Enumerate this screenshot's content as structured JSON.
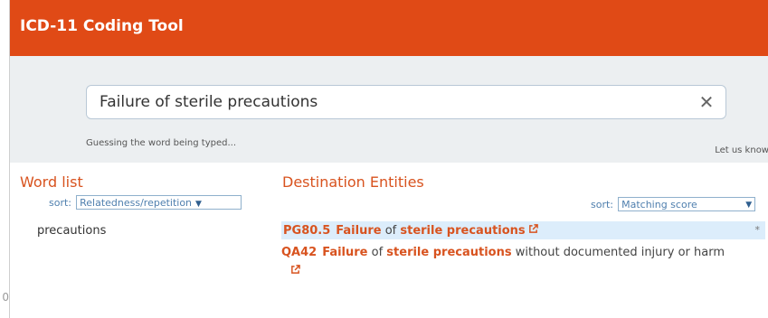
{
  "edge": {
    "digit": "0"
  },
  "header": {
    "title": "ICD-11 Coding Tool"
  },
  "search": {
    "value": "Failure of sterile precautions",
    "clear_glyph": "✕",
    "hint": "Guessing the word being typed...",
    "feedback_text": "Let us know"
  },
  "word_list": {
    "title": "Word list",
    "sort_label": "sort:",
    "sort_value": "Relatedness/repetition",
    "items": [
      "precautions"
    ]
  },
  "destination": {
    "title": "Destination Entities",
    "sort_label": "sort:",
    "sort_value": "Matching score",
    "results": [
      {
        "code": "PG80.5",
        "w1": "Failure",
        "w2": " of ",
        "w3": "sterile precautions",
        "rest": "",
        "marker": "*",
        "highlighted": true
      },
      {
        "code": "QA42",
        "w1": "Failure",
        "w2": " of ",
        "w3": "sterile precautions",
        "rest": " without documented injury or harm",
        "highlighted": false
      }
    ]
  },
  "colors": {
    "brand": "#e04a16",
    "accent": "#d8531f",
    "link": "#4f7fae",
    "highlight": "#dcedfb"
  },
  "icons": {
    "external_link": "external-link-icon",
    "clear": "close-icon",
    "dropdown": "chevron-down-icon"
  }
}
